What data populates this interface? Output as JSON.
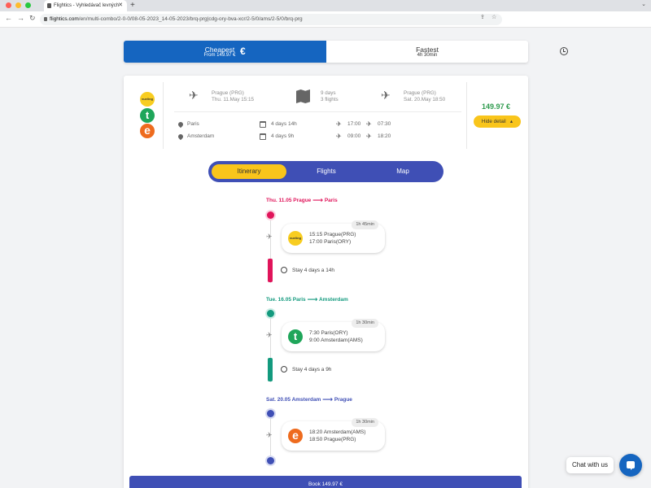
{
  "browser": {
    "tab_title": "Flightics - Vyhledávač levných",
    "tab_close": "✕",
    "new_tab": "+",
    "url_domain": "flightics.com",
    "url_path": "/en/multi-combo/2-0-0/08-05-2023_14-05-2023/brq-prg|cdg-ory-bva-xcr/2-5/0/ams/2-5/0/brq-prg"
  },
  "sort": {
    "cheapest_title": "Cheapest",
    "cheapest_sub": "From 149.97 €",
    "cheapest_icon": "€",
    "fastest_title": "Fastest",
    "fastest_sub": "4h 30min"
  },
  "summary": {
    "airlines": [
      "vueling",
      "t",
      "e"
    ],
    "depart_city": "Prague (PRG)",
    "depart_date": "Thu. 11.May 15:15",
    "trip_days": "9 days",
    "trip_flights": "3 flights",
    "return_city": "Prague (PRG)",
    "return_date": "Sat. 20.May 18:50",
    "stops": [
      {
        "city": "Paris",
        "stay": "4 days 14h",
        "arrive": "17:00",
        "depart": "07:30"
      },
      {
        "city": "Amsterdam",
        "stay": "4 days 9h",
        "arrive": "09:00",
        "depart": "18:20"
      }
    ],
    "price": "149.97 €",
    "hide_label": "Hide detail"
  },
  "tabs": [
    "Itinerary",
    "Flights",
    "Map"
  ],
  "legs": [
    {
      "date": "Thu. 11.05",
      "from": "Prague",
      "to": "Paris",
      "color": "#e0145a",
      "airline": "vueling",
      "duration": "1h 45min",
      "line1": "15:15 Prague(PRG)",
      "line2": "17:00 Paris(ORY)",
      "stay": "Stay 4 days a 14h"
    },
    {
      "date": "Tue. 16.05",
      "from": "Paris",
      "to": "Amsterdam",
      "color": "#139a7e",
      "airline": "t",
      "duration": "1h 30min",
      "line1": "7:30 Paris(ORY)",
      "line2": "9:00 Amsterdam(AMS)",
      "stay": "Stay 4 days a 9h"
    },
    {
      "date": "Sat. 20.05",
      "from": "Amsterdam",
      "to": "Prague",
      "color": "#3f4fb5",
      "airline": "e",
      "duration": "1h 30min",
      "line1": "18:20 Amsterdam(AMS)",
      "line2": "18:50 Prague(PRG)"
    }
  ],
  "book_label": "Book 149.97 €",
  "chat_label": "Chat with us"
}
